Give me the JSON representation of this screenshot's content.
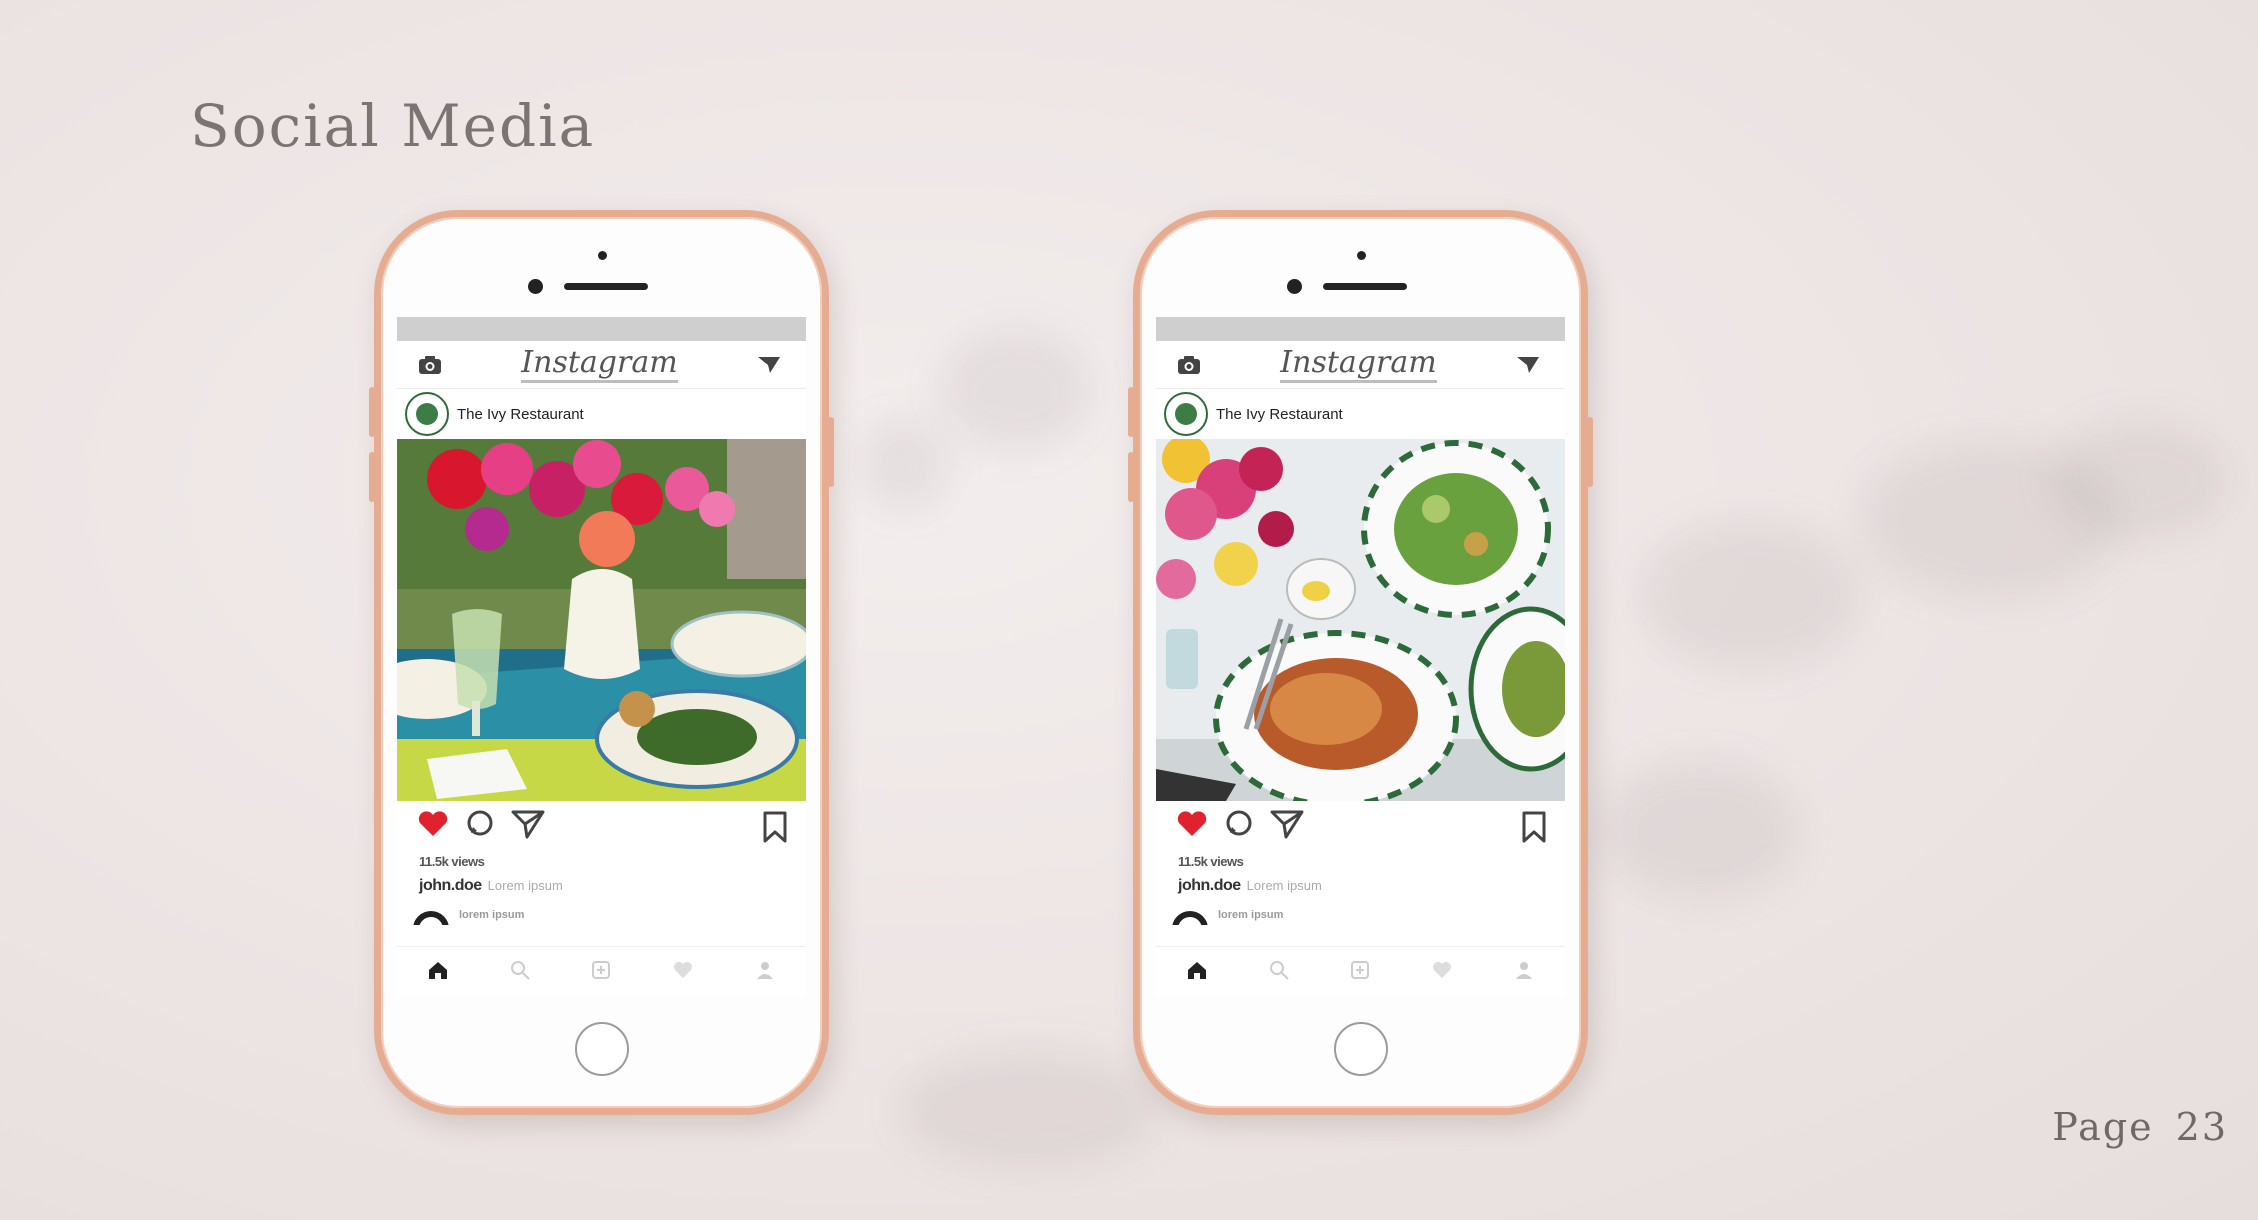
{
  "slide": {
    "title": "Social Media",
    "page_word": "Page",
    "page_number": "23"
  },
  "phones": [
    {
      "app_name": "Instagram",
      "account": "The Ivy Restaurant",
      "views": "11.5k views",
      "user": "john.doe",
      "caption": "Lorem ipsum",
      "comment": "lorem ipsum",
      "photo": "flowers-table-setting"
    },
    {
      "app_name": "Instagram",
      "account": "The Ivy Restaurant",
      "views": "11.5k views",
      "user": "john.doe",
      "caption": "Lorem ipsum",
      "comment": "lorem ipsum",
      "photo": "pasta-salad-table"
    }
  ],
  "icons": {
    "camera": "camera-icon",
    "direct": "send-icon",
    "like": "heart-icon",
    "comment": "comment-icon",
    "share": "send-icon",
    "save": "bookmark-icon",
    "nav": [
      "home-icon",
      "search-icon",
      "add-icon",
      "activity-heart-icon",
      "profile-icon"
    ]
  },
  "colors": {
    "phone_frame": "#e6ac92",
    "like_red": "#e2212e",
    "background": "#ece4e3",
    "brand_green": "#3b7d44"
  }
}
